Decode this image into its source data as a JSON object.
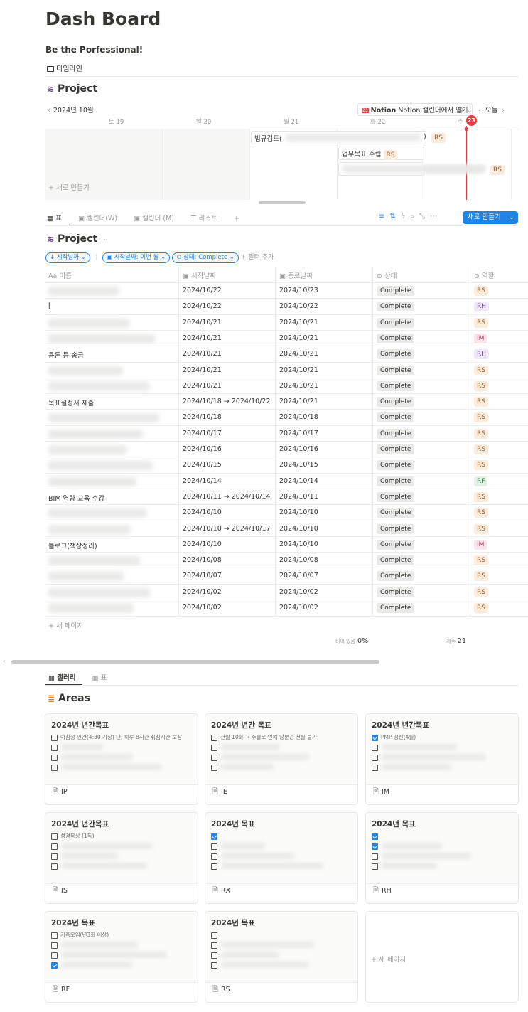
{
  "page": {
    "title": "Dash Board",
    "subtitle": "Be the Porfessional!",
    "timeline_link": "타임라인"
  },
  "project_timeline": {
    "title": "Project",
    "month": "2024년 10월",
    "open_calendar_label": "Notion 캘린더에서 열기",
    "view_mode": "주",
    "today_label": "오늘",
    "days": [
      "토 19",
      "일 20",
      "월 21",
      "화 22",
      "수"
    ],
    "today_num": "23",
    "bars": [
      {
        "label": "법규검토(",
        "tag": "RS"
      },
      {
        "label": "업무목표 수립",
        "tag": "RS"
      },
      {
        "label": "",
        "tag": "RS"
      }
    ],
    "new_label": "+ 새로 만들기"
  },
  "view_tabs": [
    "표",
    "캘린더(W)",
    "캘린더 (M)",
    "리스트",
    "+"
  ],
  "new_button": "새로 만들기",
  "project_table": {
    "title": "Project",
    "filters": [
      "↓ 시작날짜",
      "시작날짜: 이번 월",
      "상태: Complete",
      "+ 필터 추가"
    ],
    "columns": [
      "Aa 이름",
      "시작날짜",
      "종료날짜",
      "상태",
      "역할"
    ],
    "rows": [
      {
        "name": "",
        "start": "2024/10/22",
        "end": "2024/10/23",
        "status": "Complete",
        "role": "RS"
      },
      {
        "name": "[",
        "start": "2024/10/22",
        "end": "2024/10/22",
        "status": "Complete",
        "role": "RH"
      },
      {
        "name": "",
        "start": "2024/10/21",
        "end": "2024/10/21",
        "status": "Complete",
        "role": "RS"
      },
      {
        "name": "",
        "start": "2024/10/21",
        "end": "2024/10/21",
        "status": "Complete",
        "role": "IM"
      },
      {
        "name": "용돈 등 송금",
        "start": "2024/10/21",
        "end": "2024/10/21",
        "status": "Complete",
        "role": "RH"
      },
      {
        "name": "",
        "start": "2024/10/21",
        "end": "2024/10/21",
        "status": "Complete",
        "role": "RS"
      },
      {
        "name": "",
        "start": "2024/10/21",
        "end": "2024/10/21",
        "status": "Complete",
        "role": "RS"
      },
      {
        "name": "목표설정서 제출",
        "start": "2024/10/18 → 2024/10/22",
        "end": "2024/10/21",
        "status": "Complete",
        "role": "RS"
      },
      {
        "name": "",
        "start": "2024/10/18",
        "end": "2024/10/18",
        "status": "Complete",
        "role": "RS"
      },
      {
        "name": "",
        "start": "2024/10/17",
        "end": "2024/10/17",
        "status": "Complete",
        "role": "RS"
      },
      {
        "name": "",
        "start": "2024/10/16",
        "end": "2024/10/16",
        "status": "Complete",
        "role": "RS"
      },
      {
        "name": "",
        "start": "2024/10/15",
        "end": "2024/10/15",
        "status": "Complete",
        "role": "RS"
      },
      {
        "name": "",
        "start": "2024/10/14",
        "end": "2024/10/14",
        "status": "Complete",
        "role": "RF"
      },
      {
        "name": "BIM 역량 교육 수강",
        "start": "2024/10/11 → 2024/10/14",
        "end": "2024/10/11",
        "status": "Complete",
        "role": "RS"
      },
      {
        "name": "",
        "start": "2024/10/10",
        "end": "2024/10/10",
        "status": "Complete",
        "role": "RS"
      },
      {
        "name": "",
        "start": "2024/10/10 → 2024/10/17",
        "end": "2024/10/10",
        "status": "Complete",
        "role": "RS"
      },
      {
        "name": "블로그(책상정리)",
        "start": "2024/10/10",
        "end": "2024/10/10",
        "status": "Complete",
        "role": "IM"
      },
      {
        "name": "",
        "start": "2024/10/08",
        "end": "2024/10/08",
        "status": "Complete",
        "role": "RS"
      },
      {
        "name": "",
        "start": "2024/10/07",
        "end": "2024/10/07",
        "status": "Complete",
        "role": "RS"
      },
      {
        "name": "",
        "start": "2024/10/02",
        "end": "2024/10/02",
        "status": "Complete",
        "role": "RS"
      },
      {
        "name": "",
        "start": "2024/10/02",
        "end": "2024/10/02",
        "status": "Complete",
        "role": "RS"
      }
    ],
    "new_page": "+ 새 페이지",
    "empty_label": "비어 있음",
    "empty_value": "0%",
    "count_label": "개수",
    "count_value": "21"
  },
  "areas": {
    "tabs": [
      "갤러리",
      "표"
    ],
    "title": "Areas",
    "cards": [
      {
        "title": "2024년 년간목표",
        "first_item": "아침형 인간(4:30 기상) 단, 하루 8시간 취침시간 보장",
        "name": "IP"
      },
      {
        "title": "2024년 년간 목표",
        "first_item": "천월 10화 → 수술로 인해 당분간 천월 불가",
        "name": "IE"
      },
      {
        "title": "2024년 년간목표",
        "first_item": "PMP 갱신(4월)",
        "name": "IM"
      },
      {
        "title": "2024년 년간목표",
        "first_item": "성경묵상 (1독)",
        "name": "IS"
      },
      {
        "title": "2024년 목표",
        "first_item": "",
        "name": "RX"
      },
      {
        "title": "2024년 목표",
        "first_item": "",
        "name": "RH"
      },
      {
        "title": "2024년 목표",
        "first_item": "가족모임(년3회 이상)",
        "name": "RF"
      },
      {
        "title": "2024년 목표",
        "first_item": "",
        "name": "RS"
      }
    ],
    "new_page": "+ 새 페이지"
  }
}
